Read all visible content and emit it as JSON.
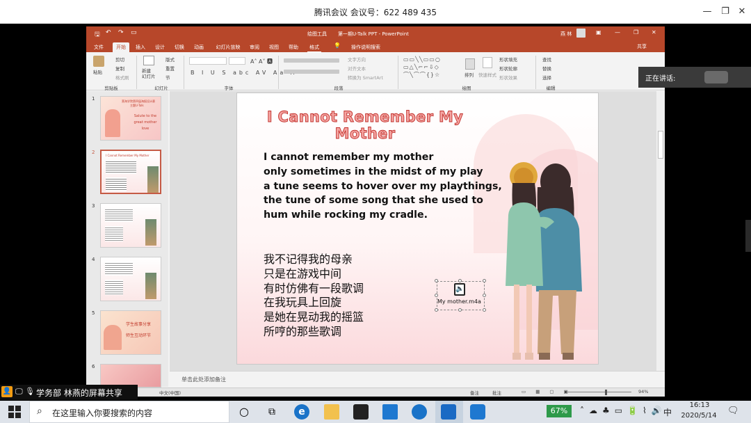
{
  "meeting": {
    "title": "腾讯会议 会议号：622 489 435"
  },
  "ppt": {
    "title": "第一期U-Talk PPT  -  PowerPoint",
    "tool_context": "绘图工具",
    "user": "燕 林",
    "share": "共享",
    "tabs": [
      "文件",
      "开始",
      "插入",
      "设计",
      "切换",
      "动画",
      "幻灯片放映",
      "审阅",
      "视图",
      "帮助",
      "格式"
    ],
    "tell_me": "操作说明搜索",
    "ribbon": {
      "clipboard": {
        "paste": "粘贴",
        "cut": "剪切",
        "copy": "复制",
        "format_painter": "格式刷",
        "group": "剪贴板"
      },
      "slides": {
        "new_slide": "新建\n幻灯片",
        "layout": "版式",
        "reset": "重置",
        "section": "节",
        "group": "幻灯片"
      },
      "font": {
        "group": "字体"
      },
      "paragraph": {
        "text_direction": "文字方向",
        "align_text": "对齐文本",
        "smartart": "转换为 SmartArt",
        "group": "段落"
      },
      "drawing": {
        "arrange": "排列",
        "quick_styles": "快速样式",
        "fill": "形状填充",
        "outline": "形状轮廓",
        "effects": "形状效果",
        "group": "绘图"
      },
      "editing": {
        "find": "查找",
        "replace": "替换",
        "select": "选择",
        "group": "编辑"
      }
    },
    "thumbnails": [
      {
        "num": "1",
        "title": "营海学院第四届海报设计赛",
        "line2": "主题U-Talk",
        "text": "Salute to the great mother love"
      },
      {
        "num": "2",
        "title": "I Cannot Remember My Mother"
      },
      {
        "num": "3"
      },
      {
        "num": "4"
      },
      {
        "num": "5",
        "text1": "学生故事分享",
        "text2": "师生互动环节"
      },
      {
        "num": "6"
      }
    ],
    "slide": {
      "title": "I Cannot Remember My Mother",
      "poem_en": [
        "I cannot remember my mother",
        "only sometimes in the midst of my play",
        "a tune seems to hover over my playthings,",
        "the tune of some song that she used to",
        "hum while rocking my cradle."
      ],
      "poem_cn": [
        "我不记得我的母亲",
        "只是在游戏中间",
        "有时仿佛有一段歌调",
        "在我玩具上回旋",
        "是她在晃动我的摇篮",
        "所哼的那些歌调"
      ],
      "audio_label": "My mother.m4a"
    },
    "notes_placeholder": "单击此处添加备注",
    "status": {
      "lang": "中文(中国)",
      "notes": "备注",
      "comments": "批注",
      "zoom": "94%"
    }
  },
  "speaking": {
    "label": "正在讲话:"
  },
  "share_label": "学务部 林燕的屏幕共享",
  "taskbar": {
    "search_placeholder": "在这里输入你要搜索的内容",
    "battery": "67%",
    "ime": "中",
    "time": "16:13",
    "date": "2020/5/14"
  },
  "colors": {
    "ppt_accent": "#b7472a",
    "title_fill": "#f4a3a0",
    "title_stroke": "#c0302b"
  }
}
